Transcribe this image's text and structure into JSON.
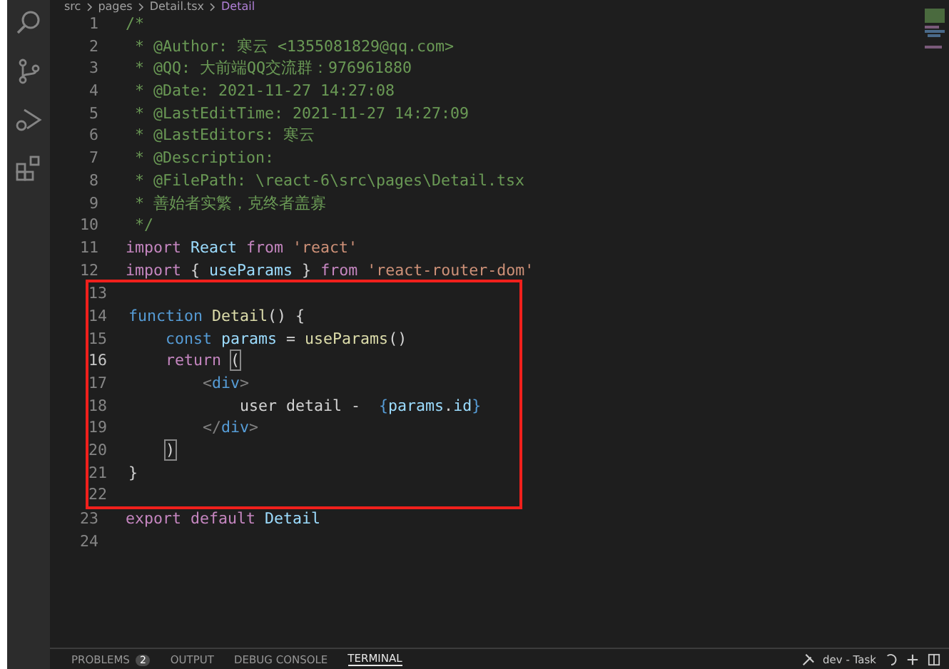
{
  "breadcrumb": [
    {
      "text": "src",
      "kind": "folder"
    },
    {
      "text": "pages",
      "kind": "folder"
    },
    {
      "text": "Detail.tsx",
      "kind": "file"
    },
    {
      "text": "Detail",
      "kind": "symbol"
    }
  ],
  "activity_bar": [
    {
      "kind": "search"
    },
    {
      "kind": "source-control"
    },
    {
      "kind": "run-debug"
    },
    {
      "kind": "extensions"
    }
  ],
  "editor": {
    "sections": [
      {
        "highlighted": false,
        "lines": [
          {
            "number": "1",
            "current": false,
            "tokens": [
              {
                "kind": "comment",
                "text": "/*"
              }
            ]
          },
          {
            "number": "2",
            "current": false,
            "tokens": [
              {
                "kind": "comment",
                "text": " * @Author: 寒云 <1355081829@qq.com>"
              }
            ]
          },
          {
            "number": "3",
            "current": false,
            "tokens": [
              {
                "kind": "comment",
                "text": " * @QQ: 大前端QQ交流群：976961880"
              }
            ]
          },
          {
            "number": "4",
            "current": false,
            "tokens": [
              {
                "kind": "comment",
                "text": " * @Date: 2021-11-27 14:27:08"
              }
            ]
          },
          {
            "number": "5",
            "current": false,
            "tokens": [
              {
                "kind": "comment",
                "text": " * @LastEditTime: 2021-11-27 14:27:09"
              }
            ]
          },
          {
            "number": "6",
            "current": false,
            "tokens": [
              {
                "kind": "comment",
                "text": " * @LastEditors: 寒云"
              }
            ]
          },
          {
            "number": "7",
            "current": false,
            "tokens": [
              {
                "kind": "comment",
                "text": " * @Description:"
              }
            ]
          },
          {
            "number": "8",
            "current": false,
            "tokens": [
              {
                "kind": "comment",
                "text": " * @FilePath: \\react-6\\src\\pages\\Detail.tsx"
              }
            ]
          },
          {
            "number": "9",
            "current": false,
            "tokens": [
              {
                "kind": "comment",
                "text": " * 善始者实繁，克终者盖寡"
              }
            ]
          },
          {
            "number": "10",
            "current": false,
            "tokens": [
              {
                "kind": "comment",
                "text": " */"
              }
            ]
          },
          {
            "number": "11",
            "current": false,
            "tokens": [
              {
                "kind": "control",
                "text": "import"
              },
              {
                "kind": "variable",
                "text": " React"
              },
              {
                "kind": "control",
                "text": " from"
              },
              {
                "kind": "string",
                "text": " 'react'"
              }
            ]
          },
          {
            "number": "12",
            "current": false,
            "tokens": [
              {
                "kind": "control",
                "text": "import"
              },
              {
                "kind": "plain",
                "text": " {"
              },
              {
                "kind": "variable",
                "text": " useParams"
              },
              {
                "kind": "plain",
                "text": " }"
              },
              {
                "kind": "control",
                "text": " from"
              },
              {
                "kind": "string",
                "text": " 'react-router-dom'"
              }
            ]
          }
        ]
      },
      {
        "highlighted": true,
        "lines": [
          {
            "number": "13",
            "current": false
          },
          {
            "number": "14",
            "current": false,
            "tokens": [
              {
                "kind": "storage",
                "text": "function"
              },
              {
                "kind": "function",
                "text": " Detail"
              },
              {
                "kind": "plain",
                "text": "() {"
              }
            ]
          },
          {
            "number": "15",
            "current": false,
            "tokens": [
              {
                "kind": "storage",
                "text": "    const"
              },
              {
                "kind": "variable",
                "text": " params"
              },
              {
                "kind": "plain",
                "text": " ="
              },
              {
                "kind": "function",
                "text": " useParams"
              },
              {
                "kind": "plain",
                "text": "()"
              }
            ]
          },
          {
            "number": "16",
            "current": true,
            "tokens": [
              {
                "kind": "control",
                "text": "    return "
              },
              {
                "kind": "bracket-match",
                "text": "("
              }
            ]
          },
          {
            "number": "17",
            "current": false,
            "tokens": [
              {
                "kind": "tag-punct",
                "text": "        <"
              },
              {
                "kind": "tag",
                "text": "div"
              },
              {
                "kind": "tag-punct",
                "text": ">"
              }
            ]
          },
          {
            "number": "18",
            "current": false,
            "tokens": [
              {
                "kind": "plain",
                "text": "            user detail -  "
              },
              {
                "kind": "storage",
                "text": "{"
              },
              {
                "kind": "variable",
                "text": "params"
              },
              {
                "kind": "plain",
                "text": "."
              },
              {
                "kind": "variable",
                "text": "id"
              },
              {
                "kind": "storage",
                "text": "}"
              }
            ]
          },
          {
            "number": "19",
            "current": false,
            "tokens": [
              {
                "kind": "tag-punct",
                "text": "        </"
              },
              {
                "kind": "tag",
                "text": "div"
              },
              {
                "kind": "tag-punct",
                "text": ">"
              }
            ]
          },
          {
            "number": "20",
            "current": false,
            "indented": true,
            "tokens": [
              {
                "kind": "bracket-match",
                "text": ")"
              }
            ]
          },
          {
            "number": "21",
            "current": false,
            "tokens": [
              {
                "kind": "plain",
                "text": "}"
              }
            ]
          },
          {
            "number": "22",
            "current": false
          }
        ]
      },
      {
        "highlighted": false,
        "lines": [
          {
            "number": "23",
            "current": false,
            "tokens": [
              {
                "kind": "control",
                "text": "export default"
              },
              {
                "kind": "variable",
                "text": " Detail"
              }
            ]
          },
          {
            "number": "24",
            "current": false
          }
        ]
      }
    ]
  },
  "panel": {
    "tabs": [
      {
        "label": "PROBLEMS",
        "badge": "2",
        "selected": false
      },
      {
        "label": "OUTPUT",
        "selected": false
      },
      {
        "label": "DEBUG CONSOLE",
        "selected": false
      },
      {
        "label": "TERMINAL",
        "selected": true
      }
    ],
    "task": "dev - Task"
  }
}
